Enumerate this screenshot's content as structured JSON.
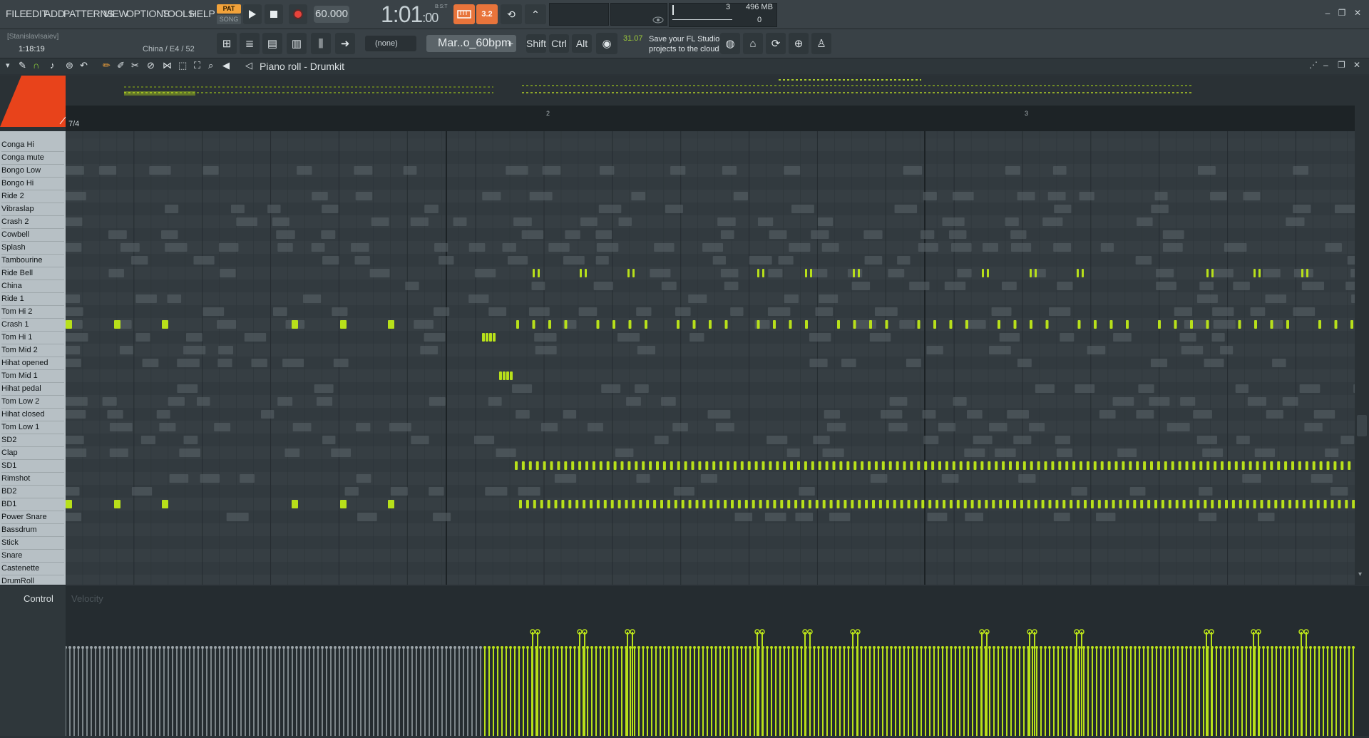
{
  "menu": {
    "items": [
      "FILE",
      "EDIT",
      "ADD",
      "PATTERNS",
      "VIEW",
      "OPTIONS",
      "TOOLS",
      "HELP"
    ]
  },
  "transport": {
    "pat_label": "PAT",
    "song_label": "SONG",
    "play_icon": "play-icon",
    "stop_icon": "stop-icon",
    "record_icon": "record-icon",
    "tempo": "60.000",
    "time_main": "1:01",
    "time_sub": ":00",
    "time_format": "B:S:T",
    "mode_buttons": [
      "typing-keyboard-icon",
      "step-edit-icon",
      "loop-record-icon",
      "metronome-icon"
    ],
    "step_label": "3.2"
  },
  "monitor": {
    "cpu_value": "3",
    "memory": "496 MB",
    "polyphony": "0"
  },
  "window": {
    "controls": [
      "minimize-icon",
      "restore-icon",
      "close-icon"
    ]
  },
  "info": {
    "user": "[StanislavIsaiev]",
    "uptime": "1:18:19",
    "hint": "China / E4 / 52"
  },
  "toolbar2": {
    "buttons": [
      "playlist-icon",
      "mixer-icon",
      "piano-roll-icon",
      "channel-rack-icon",
      "browser-icon",
      "plugin-picker-icon"
    ],
    "snap_value": "(none)",
    "pattern_name": "Mar..o_60bpm",
    "keys": [
      "Shift",
      "Ctrl",
      "Alt"
    ],
    "news_value": "31.07",
    "news_text": "Save your FL Studio projects to the cloud",
    "tail_buttons": [
      "globe-icon",
      "hat-icon",
      "cpu-meter-icon",
      "pitch-icon",
      "person-icon"
    ]
  },
  "piano_roll": {
    "title": "Piano roll - Drumkit",
    "time_sig": "7/4",
    "bar_numbers": [
      "2",
      "3"
    ],
    "control_label": "Control",
    "velocity_label": "Velocity",
    "accent_color": "#b8e01a",
    "ghost_color": "#5b6469",
    "keys": [
      "Conga Hi",
      "Conga mute",
      "Bongo Low",
      "Bongo Hi",
      "Ride 2",
      "Vibraslap",
      "Crash 2",
      "Cowbell",
      "Splash",
      "Tambourine",
      "Ride Bell",
      "China",
      "Ride 1",
      "Tom Hi 2",
      "Crash 1",
      "Tom Hi 1",
      "Tom Mid 2",
      "Hihat opened",
      "Tom Mid 1",
      "Hihat pedal",
      "Tom Low 2",
      "Hihat closed",
      "Tom Low 1",
      "SD2",
      "Clap",
      "SD1",
      "Rimshot",
      "BD2",
      "BD1",
      "Power Snare",
      "Bassdrum",
      "Stick",
      "Snare",
      "Castenette",
      "DrumRoll"
    ]
  }
}
